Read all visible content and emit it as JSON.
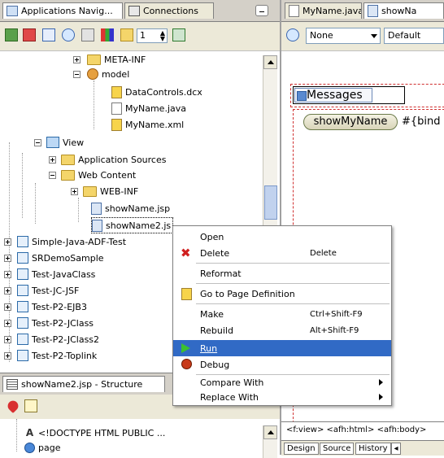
{
  "left_tabs": {
    "applications_navigator": "Applications Navig...",
    "connections": "Connections"
  },
  "toolbar": {
    "spinner_value": "1"
  },
  "tree": {
    "meta_inf": "META-INF",
    "model": "model",
    "datacontrols": "DataControls.dcx",
    "myname_java": "MyName.java",
    "myname_xml": "MyName.xml",
    "view": "View",
    "application_sources": "Application Sources",
    "web_content": "Web Content",
    "web_inf": "WEB-INF",
    "showname_jsp": "showName.jsp",
    "showname2_jsp": "showName2.js",
    "projects": [
      "Simple-Java-ADF-Test",
      "SRDemoSample",
      "Test-JavaClass",
      "Test-JC-JSF",
      "Test-P2-EJB3",
      "Test-P2-JClass",
      "Test-P2-JClass2",
      "Test-P2-Toplink"
    ]
  },
  "structure": {
    "title": "showName2.jsp - Structure",
    "items": [
      "<!DOCTYPE HTML PUBLIC ...",
      "page"
    ]
  },
  "right_tabs": {
    "myname_java": "MyName.java",
    "showname": "showNa"
  },
  "right_toolbar": {
    "select1": "None",
    "select2": "Default"
  },
  "design": {
    "messages_label": "Messages",
    "button_label": "showMyName",
    "bind_text": "#{bind"
  },
  "breadcrumb": "<f:view> <afh:html> <afh:body>",
  "bottom_tabs": [
    "Design",
    "Source",
    "History"
  ],
  "context_menu": {
    "open": "Open",
    "delete": "Delete",
    "delete_shortcut": "Delete",
    "reformat": "Reformat",
    "goto_page_def": "Go to Page Definition",
    "make": "Make",
    "make_shortcut": "Ctrl+Shift-F9",
    "rebuild": "Rebuild",
    "rebuild_shortcut": "Alt+Shift-F9",
    "run": "Run",
    "debug": "Debug",
    "compare_with": "Compare With",
    "replace_with": "Replace With"
  },
  "colors": {
    "highlight": "#316ac5",
    "folder": "#f4d56a",
    "dashed_border": "#d03030"
  }
}
